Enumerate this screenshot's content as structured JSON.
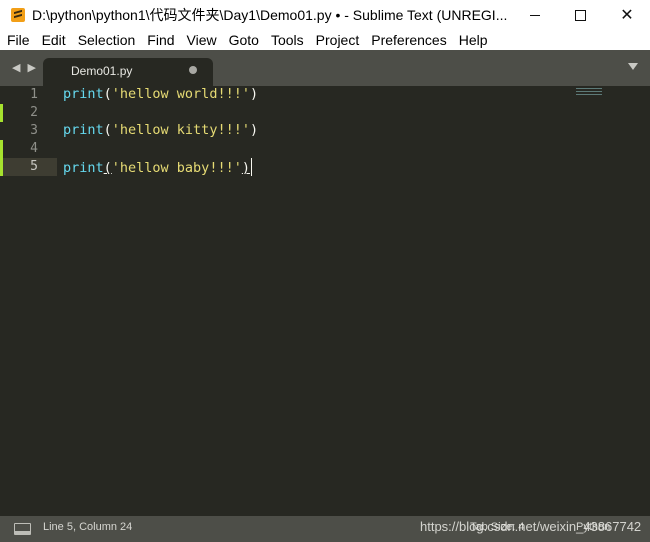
{
  "window": {
    "title": "D:\\python\\python1\\代码文件夹\\Day1\\Demo01.py • - Sublime Text (UNREGI...",
    "controls": {
      "minimize": "minimize",
      "maximize": "maximize",
      "close": "✕"
    }
  },
  "menu": [
    "File",
    "Edit",
    "Selection",
    "Find",
    "View",
    "Goto",
    "Tools",
    "Project",
    "Preferences",
    "Help"
  ],
  "tabbar": {
    "nav_arrows": "◀ ▶",
    "tab_label": "Demo01.py"
  },
  "editor": {
    "line_numbers": [
      "1",
      "2",
      "3",
      "4",
      "5"
    ],
    "lines": [
      {
        "fn": "print",
        "open": "(",
        "str": "'hellow world!!!'",
        "close": ")"
      },
      {
        "fn": "",
        "open": "",
        "str": "",
        "close": ""
      },
      {
        "fn": "print",
        "open": "(",
        "str": "'hellow kitty!!!'",
        "close": ")"
      },
      {
        "fn": "",
        "open": "",
        "str": "",
        "close": ""
      },
      {
        "fn": "print",
        "open": "(",
        "str": "'hellow baby!!!'",
        "close": ")"
      }
    ],
    "active_line": 5
  },
  "status": {
    "position": "Line 5, Column 24",
    "tab_size": "Tab Size: 4",
    "syntax": "Python",
    "watermark": "https://blog.csdn.net/weixin_43867742"
  },
  "colors": {
    "editor_bg": "#272822",
    "chrome_bg": "#4d4e48",
    "function": "#66d9ef",
    "string": "#e6db74",
    "modified_marker": "#a6e22e"
  }
}
